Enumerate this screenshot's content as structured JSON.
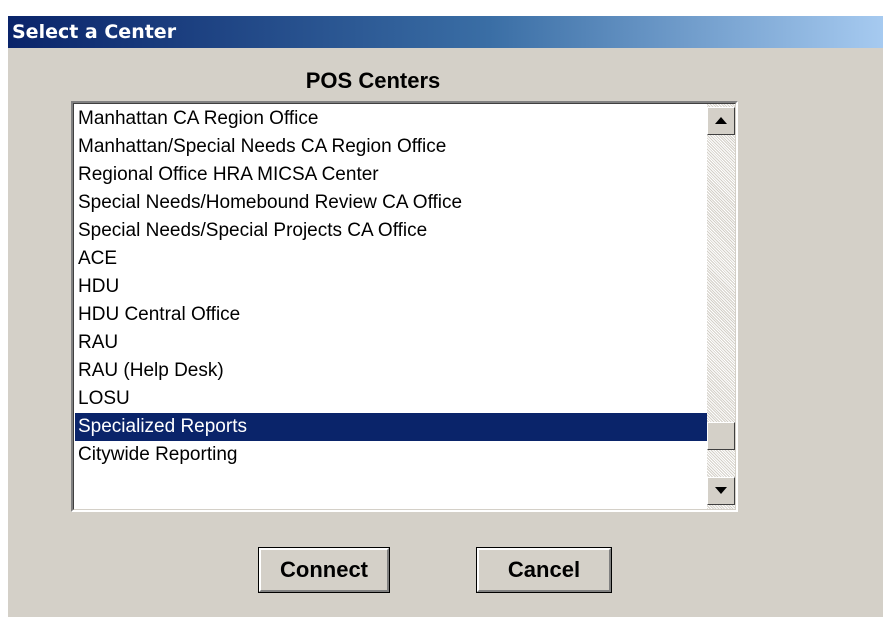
{
  "window": {
    "title": "Select a Center"
  },
  "group": {
    "label": "POS Centers"
  },
  "list": {
    "items": [
      "Manhattan CA Region Office",
      "Manhattan/Special Needs CA Region Office",
      "Regional Office HRA MICSA Center",
      "Special Needs/Homebound Review CA Office",
      "Special Needs/Special Projects CA Office",
      "ACE",
      "HDU",
      "HDU Central Office",
      "RAU",
      "RAU (Help Desk)",
      "LOSU",
      "Specialized Reports",
      "Citywide Reporting"
    ],
    "selected": "Specialized Reports"
  },
  "buttons": {
    "connect": "Connect",
    "cancel": "Cancel"
  },
  "colors": {
    "selection": "#0a246a",
    "face": "#d4d0c8",
    "titlebar": "#0a246a"
  }
}
